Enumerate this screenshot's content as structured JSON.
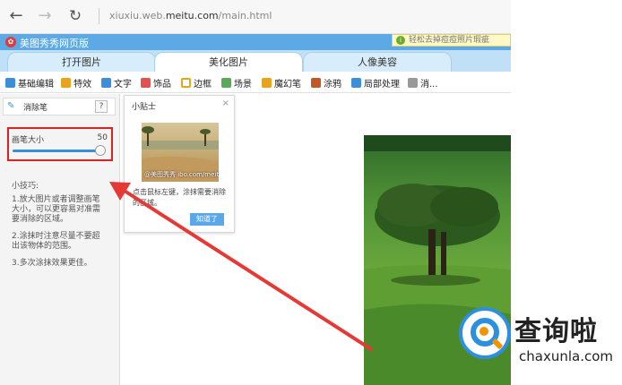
{
  "browser": {
    "address_domain_prefix": "xiuxiu.web.",
    "address_domain": "meitu.com",
    "address_path": "/main.html"
  },
  "app": {
    "name": "美图秀秀网页版",
    "promo": "轻松去掉痘痘照片瑕疵"
  },
  "main_tabs": [
    {
      "label": "打开图片"
    },
    {
      "label": "美化图片"
    },
    {
      "label": "人像美容"
    }
  ],
  "toolbar": [
    {
      "label": "基础编辑",
      "icon": "edit-icon",
      "color": "#3b8fd8"
    },
    {
      "label": "特效",
      "icon": "effect-icon",
      "color": "#e9a21e"
    },
    {
      "label": "文字",
      "icon": "text-icon",
      "color": "#3b8fd8"
    },
    {
      "label": "饰品",
      "icon": "accessory-icon",
      "color": "#e25050"
    },
    {
      "label": "边框",
      "icon": "frame-icon",
      "color": "#e9a21e"
    },
    {
      "label": "场景",
      "icon": "scene-icon",
      "color": "#5ba85b"
    },
    {
      "label": "魔幻笔",
      "icon": "magic-pen-icon",
      "color": "#e9a21e"
    },
    {
      "label": "涂鸦",
      "icon": "doodle-icon",
      "color": "#c2572a"
    },
    {
      "label": "局部处理",
      "icon": "local-edit-icon",
      "color": "#3b8fd8"
    },
    {
      "label": "消...",
      "icon": "eraser-icon",
      "color": "#999999"
    }
  ],
  "left_panel": {
    "title": "消除笔",
    "help": "?",
    "brush_size_label": "画笔大小",
    "brush_size_value": "50",
    "brush_size_fraction": 1.0,
    "tips_title": "小技巧:",
    "tips": [
      "1.放大图片或者调整画笔大小，可以更容易对准需要消除的区域。",
      "2.涂抹时注意尽量不要超出该物体的范围。",
      "3.多次涂抹效果更佳。"
    ]
  },
  "popup": {
    "title": "小贴士",
    "close": "×",
    "watermark": "@美图秀秀 ibo.com/meituxiuxiu",
    "text": "点击鼠标左键，涂抹需要消除的区域。",
    "button": "知道了"
  },
  "site_watermark": {
    "cn": "查询啦",
    "en": "chaxunla.com"
  }
}
